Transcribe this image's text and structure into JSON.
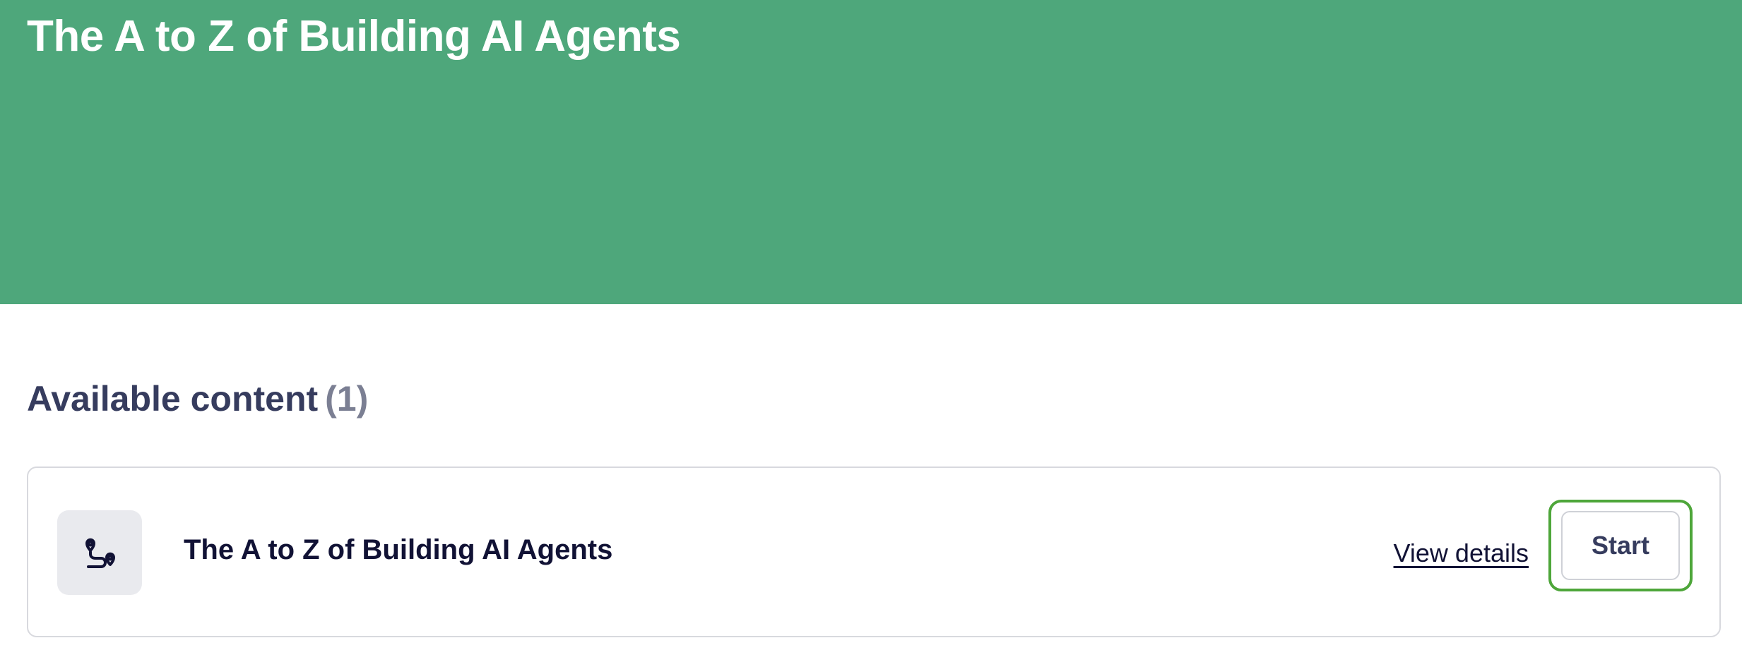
{
  "hero": {
    "title": "The A to Z of Building AI Agents",
    "background_color": "#4ea77b"
  },
  "content_section": {
    "heading": "Available content",
    "count": "(1)"
  },
  "items": [
    {
      "icon": "route-pin-icon",
      "title": "The A to Z of Building AI Agents",
      "view_details_label": "View details",
      "start_label": "Start"
    }
  ],
  "colors": {
    "focus_ring": "#4ea63a",
    "heading_text": "#363c5e",
    "title_text": "#111235"
  }
}
